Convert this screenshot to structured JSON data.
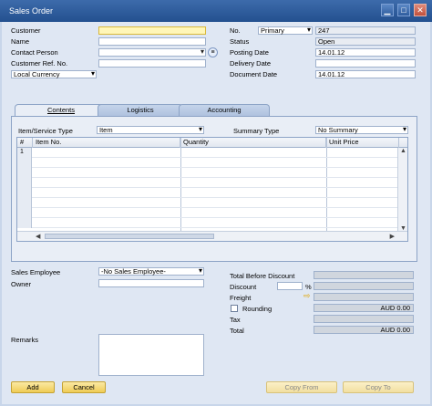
{
  "window": {
    "title": "Sales Order"
  },
  "header_left": {
    "customer_label": "Customer",
    "name_label": "Name",
    "contact_label": "Contact Person",
    "refno_label": "Customer Ref. No.",
    "currency_value": "Local Currency"
  },
  "header_right": {
    "no_label": "No.",
    "series_value": "Primary",
    "doc_number": "247",
    "status_label": "Status",
    "status_value": "Open",
    "posting_label": "Posting Date",
    "posting_value": "14.01.12",
    "delivery_label": "Delivery Date",
    "docdate_label": "Document Date",
    "docdate_value": "14.01.12"
  },
  "tabs": [
    {
      "label": "Contents"
    },
    {
      "label": "Logistics"
    },
    {
      "label": "Accounting"
    }
  ],
  "contents": {
    "item_service_label": "Item/Service Type",
    "item_service_value": "Item",
    "summary_label": "Summary Type",
    "summary_value": "No Summary",
    "columns": [
      "#",
      "Item No.",
      "Quantity",
      "Unit Price"
    ],
    "first_row_number": "1"
  },
  "footer_left": {
    "sales_employee_label": "Sales Employee",
    "sales_employee_value": "-No Sales Employee-",
    "owner_label": "Owner",
    "remarks_label": "Remarks"
  },
  "footer_right": {
    "total_before_label": "Total Before Discount",
    "discount_label": "Discount",
    "discount_unit": "%",
    "freight_label": "Freight",
    "rounding_label": "Rounding",
    "rounding_value": "AUD 0.00",
    "tax_label": "Tax",
    "total_label": "Total",
    "total_value": "AUD 0.00"
  },
  "buttons": {
    "add": "Add",
    "cancel": "Cancel",
    "copy_from": "Copy From",
    "copy_to": "Copy To"
  },
  "colors": {
    "titlebar": "#2d5b9b",
    "button_yellow": "#f0cc55",
    "active_field": "#fff6b8"
  }
}
